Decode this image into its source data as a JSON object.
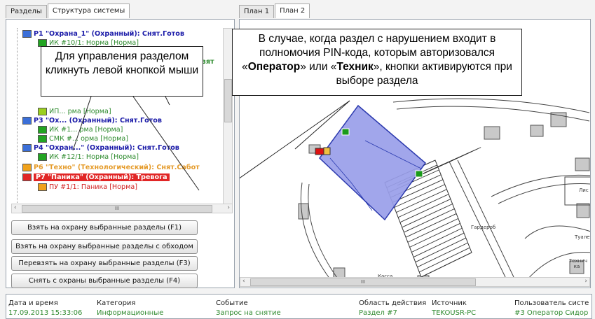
{
  "left_tabs": [
    "Разделы",
    "Структура системы"
  ],
  "right_tabs": [
    "План 1",
    "План 2"
  ],
  "tree": [
    {
      "text": "Р1 \"Охрана_1\" (Охранный): Снят.Готов",
      "color": "#1a1aa8",
      "bold": true,
      "indent": 0,
      "icon": "blue"
    },
    {
      "text": "ИК #10/1: Норма [Норма]",
      "color": "#2e8b2e",
      "bold": false,
      "indent": 1,
      "icon": "green"
    },
    {
      "text": "Взят",
      "color": "#2e8b2e",
      "bold": true,
      "indent": 0,
      "icon": "green"
    },
    {
      "text": "ИП... рма [Норма]",
      "color": "#2e8b2e",
      "bold": false,
      "indent": 1,
      "icon": "yellowgreen"
    },
    {
      "text": "Р3 \"Ох... (Охранный): Снят.Готов",
      "color": "#1a1aa8",
      "bold": true,
      "indent": 0,
      "icon": "blue"
    },
    {
      "text": "ИК #1... рма [Норма]",
      "color": "#2e8b2e",
      "bold": false,
      "indent": 1,
      "icon": "green"
    },
    {
      "text": "СМК #... орма [Норма]",
      "color": "#2e8b2e",
      "bold": false,
      "indent": 1,
      "icon": "green"
    },
    {
      "text": "Р4 \"Охран...\" (Охранный): Снят.Готов",
      "color": "#1a1aa8",
      "bold": true,
      "indent": 0,
      "icon": "blue"
    },
    {
      "text": "ИК #12/1: Норма [Норма]",
      "color": "#2e8b2e",
      "bold": false,
      "indent": 1,
      "icon": "green"
    },
    {
      "text": "Р6 \"Техно\" (Технологический): Снят.Сабот",
      "color": "#e59b2a",
      "bold": true,
      "indent": 0,
      "icon": "orange"
    },
    {
      "text": "Р7 \"Паника\" (Охранный): Тревога",
      "color": "#ffffff",
      "bold": true,
      "indent": 0,
      "icon": "red",
      "highlight": "#e12626"
    },
    {
      "text": "ПУ #1/1: Паника [Норма]",
      "color": "#d12020",
      "bold": false,
      "indent": 1,
      "icon": "orange"
    }
  ],
  "buttons": [
    "Взять на охрану выбранные разделы (F1)",
    "Взять на охрану выбранные разделы с обходом (F2)",
    "Перевзять на охрану выбранные разделы (F3)",
    "Снять с охраны выбранные разделы (F4)"
  ],
  "callouts": {
    "left": "Для управления разделом кликнуть левой кнопкой мыши",
    "right_prefix": "В случае, когда раздел с нарушением входит в полномочия PIN-кода, которым авторизовался «",
    "right_operator": "Оператор",
    "right_middle": "» или «",
    "right_tech": "Техник",
    "right_suffix": "», кнопки активируются при выборе раздела"
  },
  "plan_labels": {
    "garderob": "Гардероб",
    "kassa": "Касса",
    "tualet": "Туалет",
    "tehnika": "Технич ка",
    "lis": "Лис"
  },
  "scroll_glyph": "III",
  "events": {
    "columns": [
      "Дата и время",
      "Категория",
      "Событие",
      "Область действия",
      "Источник",
      "Пользователь систе"
    ],
    "rows": [
      [
        "17.09.2013 15:33:06",
        "Информационные",
        "Запрос на снятие",
        "Раздел #7",
        "TEKOUSR-PC",
        "#3 Оператор Сидор"
      ]
    ]
  },
  "colors": {
    "zone_fill": "#9a9fea",
    "alarm": "#e12626",
    "tree_blue": "#1a1aa8",
    "tree_green": "#2e8b2e"
  }
}
